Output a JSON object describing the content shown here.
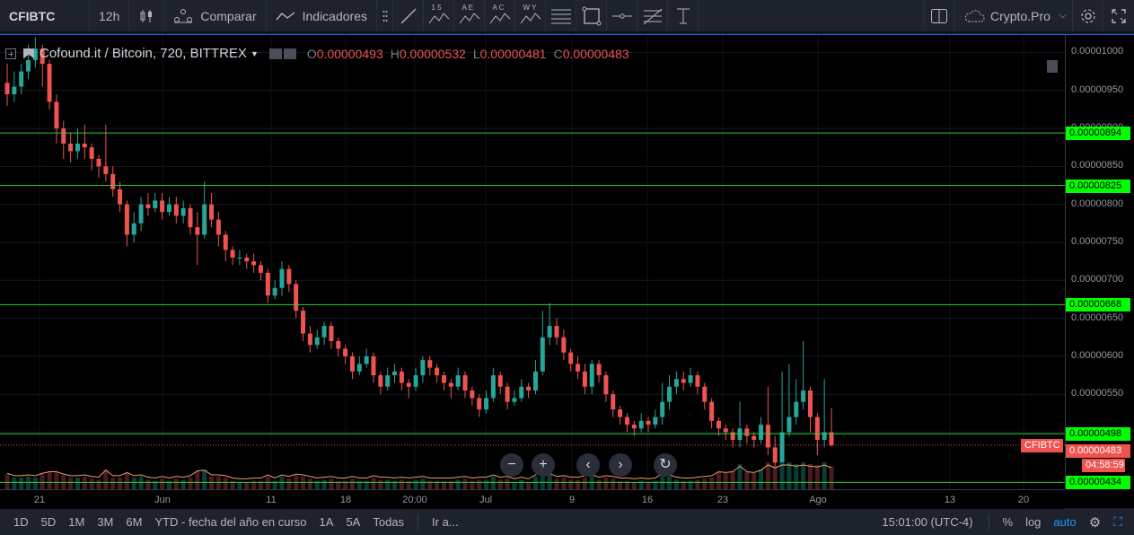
{
  "toolbar": {
    "symbol": "CFIBTC",
    "interval": "12h",
    "compare_label": "Comparar",
    "indicators_label": "Indicadores",
    "tool_letters": [
      "1 5",
      "A E",
      "A C",
      "W Y"
    ],
    "account_label": "Crypto.Pro"
  },
  "legend": {
    "title": "Cofound.it / Bitcoin, 720, BITTREX",
    "o_key": "O",
    "o_val": "0.00000493",
    "h_key": "H",
    "h_val": "0.00000532",
    "l_key": "L",
    "l_val": "0.00000481",
    "c_key": "C",
    "c_val": "0.00000483"
  },
  "chart_data": {
    "type": "candlestick",
    "symbol_label": "CFIBTC",
    "last_price": "0.00000483",
    "countdown": "04:58:59",
    "price_ticks": [
      "0.00001000",
      "0.00000950",
      "0.00000900",
      "0.00000850",
      "0.00000800",
      "0.00000750",
      "0.00000700",
      "0.00000650",
      "0.00000600",
      "0.00000550",
      "0.00000500"
    ],
    "ylim": [
      4.25e-06,
      1.023e-05
    ],
    "horizontal_lines": [
      "0.00000894",
      "0.00000825",
      "0.00000668",
      "0.00000498",
      "0.00000434"
    ],
    "time_ticks": [
      "21",
      "Jun",
      "11",
      "18",
      "20:00",
      "Jul",
      "9",
      "16",
      "23",
      "Ago",
      "13",
      "20"
    ],
    "candles": [
      [
        960,
        945,
        985,
        930
      ],
      [
        945,
        955,
        975,
        935
      ],
      [
        955,
        975,
        985,
        945
      ],
      [
        975,
        990,
        1010,
        965
      ],
      [
        990,
        1005,
        1020,
        980
      ],
      [
        1005,
        985,
        1010,
        955
      ],
      [
        985,
        935,
        990,
        925
      ],
      [
        935,
        900,
        945,
        880
      ],
      [
        900,
        880,
        910,
        860
      ],
      [
        880,
        870,
        895,
        855
      ],
      [
        870,
        880,
        900,
        860
      ],
      [
        880,
        875,
        905,
        860
      ],
      [
        875,
        860,
        880,
        845
      ],
      [
        860,
        850,
        865,
        835
      ],
      [
        850,
        840,
        905,
        830
      ],
      [
        840,
        820,
        850,
        810
      ],
      [
        820,
        800,
        830,
        790
      ],
      [
        800,
        760,
        805,
        745
      ],
      [
        760,
        775,
        790,
        750
      ],
      [
        775,
        800,
        810,
        765
      ],
      [
        800,
        795,
        815,
        785
      ],
      [
        795,
        805,
        815,
        790
      ],
      [
        805,
        790,
        815,
        780
      ],
      [
        790,
        800,
        810,
        785
      ],
      [
        800,
        785,
        810,
        775
      ],
      [
        785,
        795,
        805,
        775
      ],
      [
        795,
        770,
        800,
        760
      ],
      [
        770,
        760,
        790,
        720
      ],
      [
        760,
        800,
        830,
        755
      ],
      [
        800,
        780,
        815,
        770
      ],
      [
        780,
        760,
        790,
        745
      ],
      [
        760,
        740,
        765,
        725
      ],
      [
        740,
        730,
        745,
        720
      ],
      [
        730,
        730,
        740,
        720
      ],
      [
        730,
        725,
        735,
        715
      ],
      [
        725,
        720,
        735,
        710
      ],
      [
        720,
        710,
        725,
        700
      ],
      [
        710,
        680,
        715,
        670
      ],
      [
        680,
        690,
        700,
        675
      ],
      [
        690,
        715,
        725,
        680
      ],
      [
        715,
        695,
        720,
        685
      ],
      [
        695,
        660,
        700,
        650
      ],
      [
        660,
        630,
        665,
        620
      ],
      [
        630,
        615,
        640,
        605
      ],
      [
        615,
        625,
        635,
        610
      ],
      [
        625,
        640,
        645,
        615
      ],
      [
        640,
        620,
        645,
        610
      ],
      [
        620,
        610,
        625,
        600
      ],
      [
        610,
        600,
        615,
        590
      ],
      [
        600,
        580,
        605,
        570
      ],
      [
        580,
        590,
        600,
        575
      ],
      [
        590,
        600,
        610,
        585
      ],
      [
        600,
        575,
        605,
        565
      ],
      [
        575,
        560,
        580,
        550
      ],
      [
        560,
        575,
        585,
        555
      ],
      [
        575,
        580,
        590,
        565
      ],
      [
        580,
        565,
        585,
        555
      ],
      [
        565,
        560,
        570,
        545
      ],
      [
        560,
        575,
        585,
        555
      ],
      [
        575,
        595,
        600,
        565
      ],
      [
        595,
        585,
        600,
        575
      ],
      [
        585,
        575,
        590,
        565
      ],
      [
        575,
        565,
        580,
        555
      ],
      [
        565,
        560,
        570,
        545
      ],
      [
        560,
        575,
        585,
        555
      ],
      [
        575,
        555,
        580,
        545
      ],
      [
        555,
        545,
        560,
        535
      ],
      [
        545,
        530,
        550,
        520
      ],
      [
        530,
        545,
        555,
        525
      ],
      [
        545,
        575,
        585,
        540
      ],
      [
        575,
        560,
        580,
        550
      ],
      [
        560,
        540,
        565,
        530
      ],
      [
        540,
        545,
        555,
        535
      ],
      [
        545,
        560,
        570,
        540
      ],
      [
        560,
        555,
        565,
        545
      ],
      [
        555,
        580,
        595,
        550
      ],
      [
        580,
        625,
        660,
        575
      ],
      [
        625,
        640,
        670,
        615
      ],
      [
        640,
        625,
        650,
        615
      ],
      [
        625,
        605,
        635,
        595
      ],
      [
        605,
        590,
        610,
        580
      ],
      [
        590,
        580,
        600,
        570
      ],
      [
        580,
        560,
        590,
        550
      ],
      [
        560,
        590,
        595,
        550
      ],
      [
        590,
        575,
        595,
        565
      ],
      [
        575,
        550,
        580,
        540
      ],
      [
        550,
        530,
        555,
        520
      ],
      [
        530,
        520,
        535,
        510
      ],
      [
        520,
        510,
        525,
        500
      ],
      [
        510,
        505,
        515,
        495
      ],
      [
        505,
        515,
        525,
        500
      ],
      [
        515,
        510,
        520,
        500
      ],
      [
        510,
        520,
        530,
        505
      ],
      [
        520,
        540,
        565,
        510
      ],
      [
        540,
        560,
        575,
        530
      ],
      [
        560,
        570,
        580,
        550
      ],
      [
        570,
        565,
        580,
        555
      ],
      [
        565,
        575,
        585,
        560
      ],
      [
        575,
        560,
        580,
        550
      ],
      [
        560,
        540,
        565,
        530
      ],
      [
        540,
        515,
        545,
        505
      ],
      [
        515,
        505,
        520,
        495
      ],
      [
        505,
        500,
        510,
        490
      ],
      [
        500,
        490,
        505,
        480
      ],
      [
        490,
        505,
        540,
        480
      ],
      [
        505,
        495,
        510,
        485
      ],
      [
        495,
        490,
        500,
        480
      ],
      [
        490,
        510,
        520,
        485
      ],
      [
        510,
        480,
        560,
        470
      ],
      [
        480,
        460,
        495,
        445
      ],
      [
        460,
        500,
        580,
        455
      ],
      [
        500,
        520,
        590,
        495
      ],
      [
        520,
        540,
        570,
        510
      ],
      [
        540,
        555,
        620,
        530
      ],
      [
        555,
        520,
        560,
        500
      ],
      [
        520,
        490,
        525,
        470
      ],
      [
        490,
        500,
        570,
        480
      ],
      [
        500,
        483,
        532,
        481
      ]
    ]
  },
  "bottombar": {
    "ranges": [
      "1D",
      "5D",
      "1M",
      "3M",
      "6M",
      "YTD - fecha del año en curso",
      "1A",
      "5A",
      "Todas"
    ],
    "goto_label": "Ir a...",
    "time": "15:01:00 (UTC-4)",
    "pct": "%",
    "log": "log",
    "auto": "auto"
  }
}
